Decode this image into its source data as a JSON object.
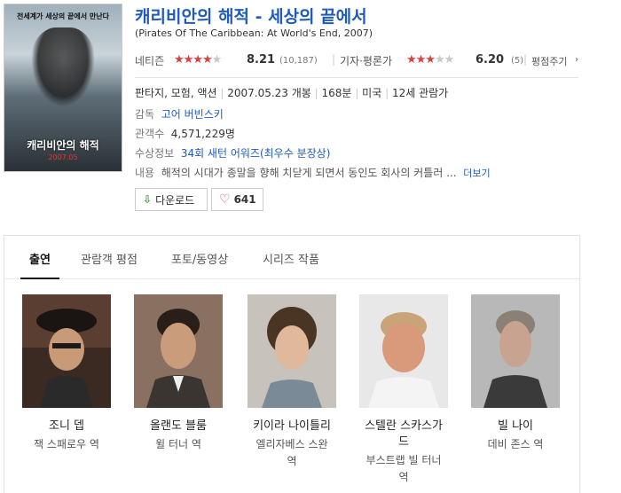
{
  "movie": {
    "title": "캐리비안의 해적 - 세상의 끝에서",
    "subtitle": "(Pirates Of The Caribbean: At World's End, 2007)",
    "poster": {
      "tagline": "전세계가 세상의 끝에서 만난다",
      "title": "캐리비안의 해적",
      "date": "2007.05"
    },
    "netizen": {
      "label": "네티즌",
      "score": "8.21",
      "count": "(10,187)",
      "stars": 4
    },
    "critic": {
      "label": "기자·평론가",
      "score": "6.20",
      "count": "(5)",
      "stars": 3
    },
    "rate_link": "평점주기",
    "meta": {
      "genre": "판타지, 모험, 액션",
      "release": "2007.05.23 개봉",
      "runtime": "168분",
      "country": "미국",
      "grade": "12세 관람가"
    },
    "director": {
      "label": "감독",
      "value": "고어 버빈스키"
    },
    "audience": {
      "label": "관객수",
      "value": "4,571,229명"
    },
    "awards": {
      "label": "수상정보",
      "value": "34회 새턴 어워즈(최우수 분장상)"
    },
    "plot": {
      "label": "내용",
      "value": "해적의 시대가 종말을 향해 치닫게 되면서 동인도 회사의 커틀러 ...",
      "more": "더보기"
    }
  },
  "buttons": {
    "download": "다운로드",
    "like_count": "641"
  },
  "tabs": [
    "출연",
    "관람객 평점",
    "포토/동영상",
    "시리즈 작품"
  ],
  "cast": [
    {
      "name": "조니 뎁",
      "role": "잭 스패로우 역"
    },
    {
      "name": "올랜도 블룸",
      "role": "윌 터너 역"
    },
    {
      "name": "키이라 나이틀리",
      "role_line1": "엘리자베스 스완",
      "role_line2": "역"
    },
    {
      "name_line1": "스텔란 스카스가",
      "name_line2": "드",
      "role_line1": "부스트랩 빌 터너",
      "role_line2": "역"
    },
    {
      "name": "빌 나이",
      "role": "데비 존스 역"
    }
  ],
  "colors": {
    "link": "#1f5bbd",
    "star": "#e23c3c"
  }
}
